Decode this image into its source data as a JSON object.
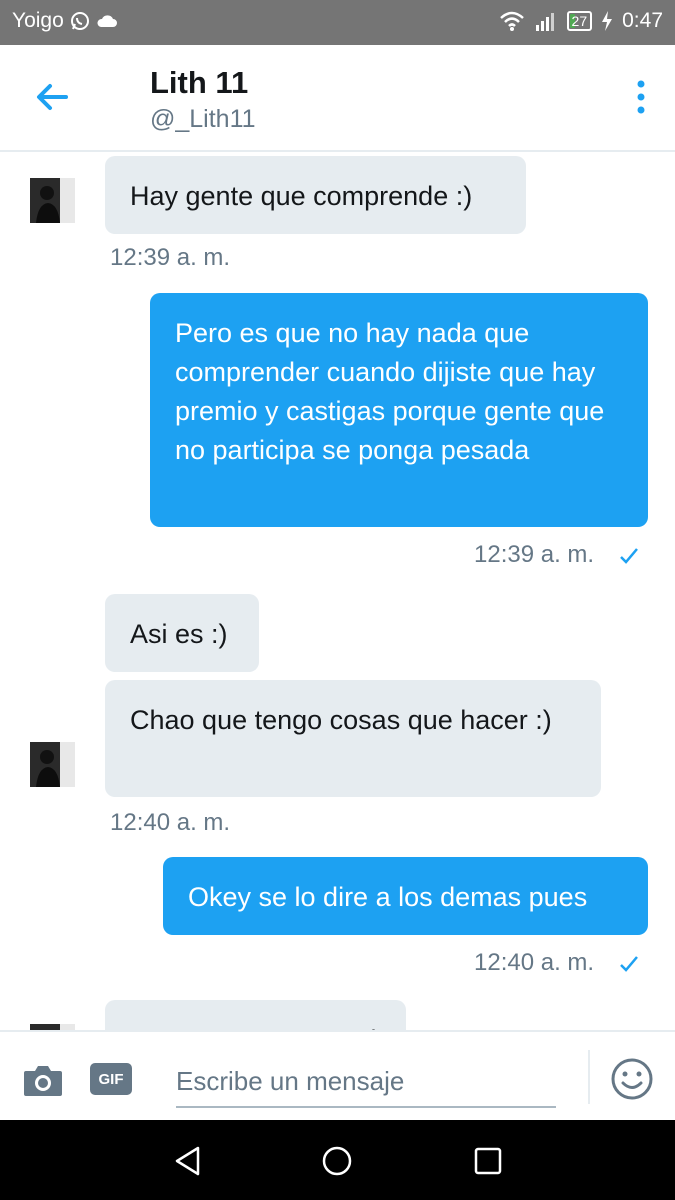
{
  "status_bar": {
    "carrier": "Yoigo",
    "battery": "27",
    "battery_level_percent": 27,
    "time": "0:47"
  },
  "header": {
    "name": "Lith 11",
    "handle": "@_Lith11",
    "back_icon": "arrow-left-icon",
    "menu_icon": "more-vertical-icon"
  },
  "messages": [
    {
      "from": "them",
      "text": "Hay gente que comprende :)"
    },
    {
      "time": "12:39 a. m."
    },
    {
      "from": "me",
      "text": "Pero es que no hay nada que comprender cuando dijiste que hay premio y castigas porque gente que no participa se ponga pesada"
    },
    {
      "time": "12:39 a. m."
    },
    {
      "from": "them",
      "text": "Asi es :)"
    },
    {
      "from": "them",
      "text": "Chao que tengo cosas que hacer :)"
    },
    {
      "time": "12:40 a. m."
    },
    {
      "from": "me",
      "text": "Okey se lo dire a los demas pues"
    },
    {
      "time": "12:40 a. m."
    },
    {
      "from": "them",
      "text": ":)"
    }
  ],
  "composer": {
    "placeholder": "Escribe un mensaje",
    "gif_label": "GIF"
  },
  "colors": {
    "accent": "#1da1f2",
    "received_bubble": "#e6ecf0",
    "status_bar": "#757575"
  }
}
